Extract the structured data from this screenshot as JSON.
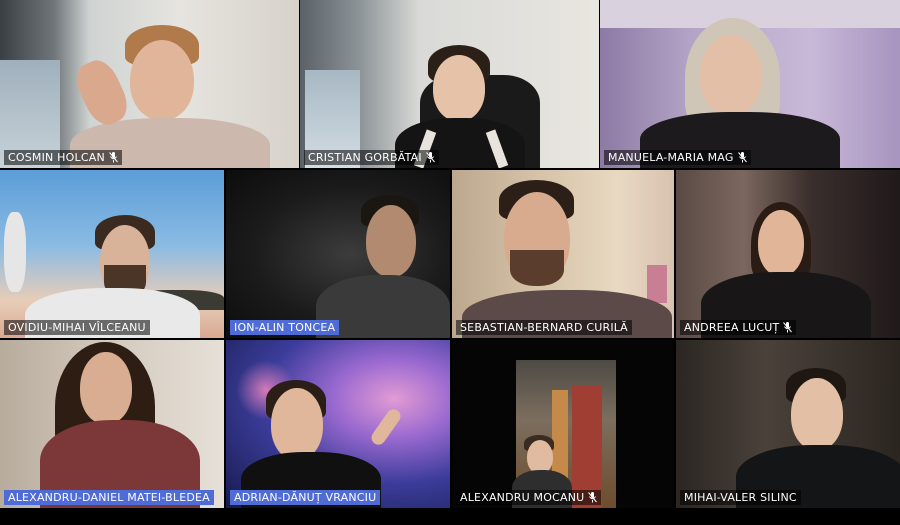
{
  "participants": [
    {
      "name": "COSMIN HOLCAN",
      "muted": true,
      "tag_style": "dark"
    },
    {
      "name": "CRISTIAN GORBĂTAI",
      "muted": true,
      "tag_style": "dark"
    },
    {
      "name": "MANUELA-MARIA MAG",
      "muted": true,
      "tag_style": "dark"
    },
    {
      "name": "OVIDIU-MIHAI VÎLCEANU",
      "muted": false,
      "tag_style": "dark"
    },
    {
      "name": "ION-ALIN TONCEA",
      "muted": false,
      "tag_style": "highlighted"
    },
    {
      "name": "SEBASTIAN-BERNARD CURILĂ",
      "muted": false,
      "tag_style": "dark"
    },
    {
      "name": "ANDREEA LUCUȚ",
      "muted": true,
      "tag_style": "dark"
    },
    {
      "name": "ALEXANDRU-DANIEL MATEI-BLEDEA",
      "muted": false,
      "tag_style": "highlighted"
    },
    {
      "name": "ADRIAN-DĂNUȚ VRANCIU",
      "muted": false,
      "tag_style": "highlighted"
    },
    {
      "name": "ALEXANDRU MOCANU",
      "muted": true,
      "tag_style": "dark"
    },
    {
      "name": "MIHAI-VALER SILINC",
      "muted": false,
      "tag_style": "dark"
    }
  ],
  "colors": {
    "highlight_tag": "#4f6bd6",
    "dark_tag": "rgba(0,0,0,0.55)"
  }
}
